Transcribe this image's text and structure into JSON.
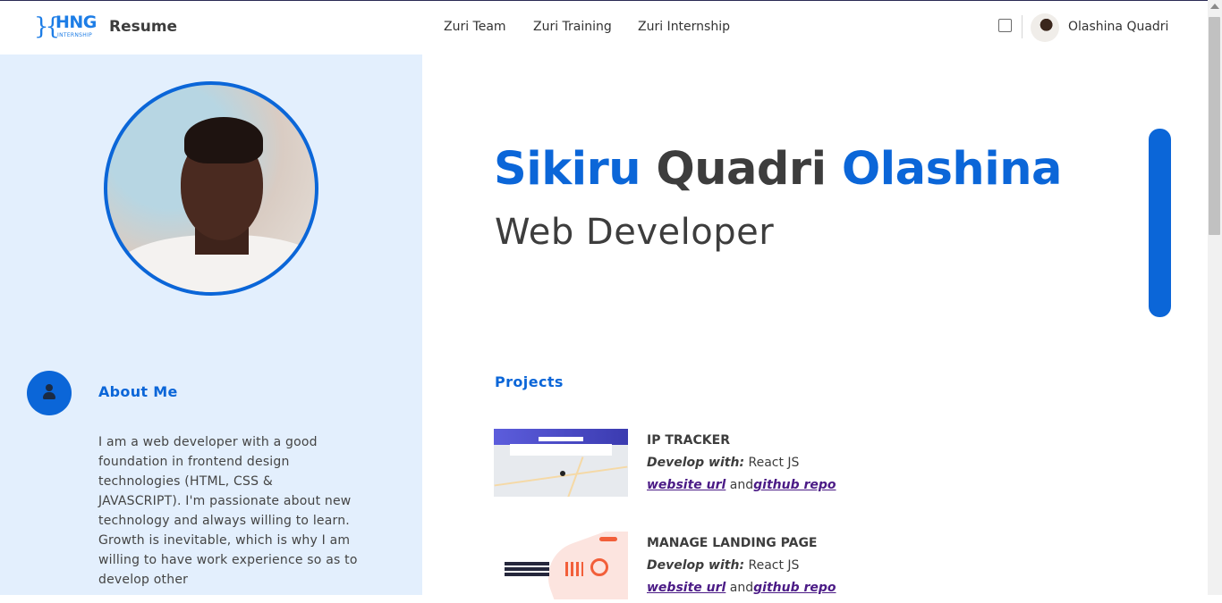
{
  "header": {
    "logo_text": "HNG",
    "logo_subtext": "INTERNSHIP",
    "brand": "Resume",
    "nav": [
      "Zuri Team",
      "Zuri Training",
      "Zuri Internship"
    ],
    "user_name": "Olashina Quadri"
  },
  "hero": {
    "first_name": "Sikiru",
    "middle_name": "Quadri",
    "last_name": "Olashina",
    "role": "Web Developer"
  },
  "sidebar": {
    "about_title": "About Me",
    "about_text": "I am a web developer with a good foundation in frontend design technologies (HTML, CSS & JAVASCRIPT). I'm passionate about new technology and always willing to learn. Growth is inevitable, which is why I am willing to have work experience so as to develop other"
  },
  "projects": {
    "title": "Projects",
    "items": [
      {
        "name": "IP TRACKER",
        "develop_label": "Develop with:",
        "tech": "React JS",
        "website_label": "website url",
        "and": "and",
        "github_label": "github repo"
      },
      {
        "name": "MANAGE LANDING PAGE",
        "develop_label": "Develop with:",
        "tech": "React JS",
        "website_label": "website url",
        "and": "and",
        "github_label": "github repo"
      }
    ]
  },
  "colors": {
    "accent": "#0b66d8",
    "sidebar_bg": "#e3effd",
    "link": "#4b1b86",
    "text": "#3d3d3d"
  }
}
